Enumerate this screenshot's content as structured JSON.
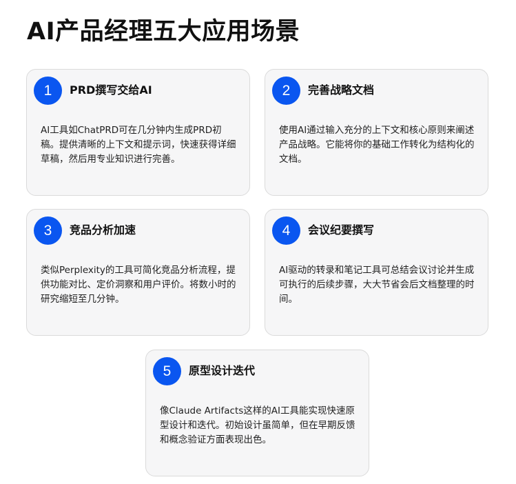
{
  "page": {
    "title": "AI产品经理五大应用场景"
  },
  "cards": [
    {
      "number": "1",
      "title": "PRD撰写交给AI",
      "body": "AI工具如ChatPRD可在几分钟内生成PRD初稿。提供清晰的上下文和提示词，快速获得详细草稿，然后用专业知识进行完善。"
    },
    {
      "number": "2",
      "title": "完善战略文档",
      "body": "使用AI通过输入充分的上下文和核心原则来阐述产品战略。它能将你的基础工作转化为结构化的文档。"
    },
    {
      "number": "3",
      "title": "竞品分析加速",
      "body": "类似Perplexity的工具可简化竞品分析流程，提供功能对比、定价洞察和用户评价。将数小时的研究缩短至几分钟。"
    },
    {
      "number": "4",
      "title": "会议纪要撰写",
      "body": "AI驱动的转录和笔记工具可总结会议讨论并生成可执行的后续步骤，大大节省会后文档整理的时间。"
    },
    {
      "number": "5",
      "title": "原型设计迭代",
      "body": "像Claude Artifacts这样的AI工具能实现快速原型设计和迭代。初始设计虽简单，但在早期反馈和概念验证方面表现出色。"
    }
  ],
  "colors": {
    "badge": "#0a56f0",
    "card_background": "#f6f6f7",
    "card_border": "#dadada"
  }
}
